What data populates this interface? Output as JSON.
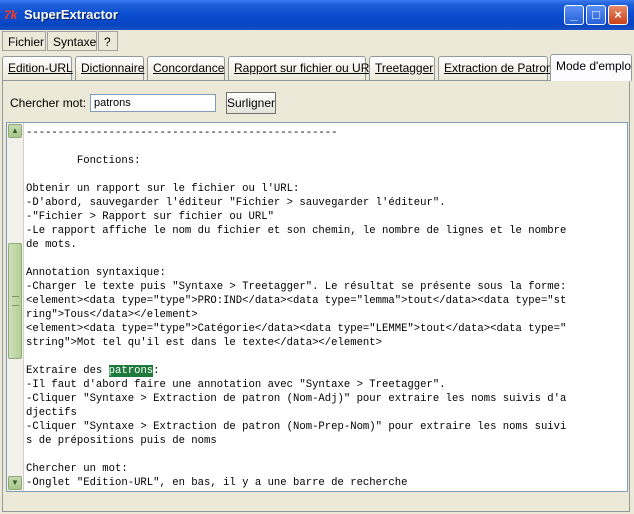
{
  "window": {
    "title": "SuperExtractor",
    "icon": "tk-feather-icon"
  },
  "menu": [
    "Fichier",
    "Syntaxe",
    "?"
  ],
  "tabs": [
    "Edition-URL",
    "Dictionnaire",
    "Concordance",
    "Rapport sur fichier ou URL",
    "Treetagger",
    "Extraction de Patron",
    "Mode d'emploi"
  ],
  "active_tab": "Mode d'emploi",
  "search": {
    "label": "Chercher mot:",
    "value": "patrons",
    "button": "Surligner"
  },
  "editor": {
    "lines": [
      "-------------------------------------------------",
      "",
      "        Fonctions:",
      "",
      "Obtenir un rapport sur le fichier ou l'URL:",
      "-D'abord, sauvegarder l'éditeur \"Fichier > sauvegarder l'éditeur\".",
      "-\"Fichier > Rapport sur fichier ou URL\"",
      "-Le rapport affiche le nom du fichier et son chemin, le nombre de lignes et le nombre",
      "de mots.",
      "",
      "Annotation syntaxique:",
      "-Charger le texte puis \"Syntaxe > Treetagger\". Le résultat se présente sous la forme:",
      "<element><data type=\"type\">PRO:IND</data><data type=\"lemma\">tout</data><data type=\"st",
      "ring\">Tous</data></element>",
      "<element><data type=\"type\">Catégorie</data><data type=\"LEMME\">tout</data><data type=\"",
      "string\">Mot tel qu'il est dans le texte</data></element>",
      "",
      "Extraire des patrons:",
      "-Il faut d'abord faire une annotation avec \"Syntaxe > Treetagger\".",
      "-Cliquer \"Syntaxe > Extraction de patron (Nom-Adj)\" pour extraire les noms suivis d'a",
      "djectifs",
      "-Cliquer \"Syntaxe > Extraction de patron (Nom-Prep-Nom)\" pour extraire les noms suivi",
      "s de prépositions puis de noms",
      "",
      "Chercher un mot:",
      "-Onglet \"Edition-URL\", en bas, il y a une barre de recherche"
    ]
  }
}
